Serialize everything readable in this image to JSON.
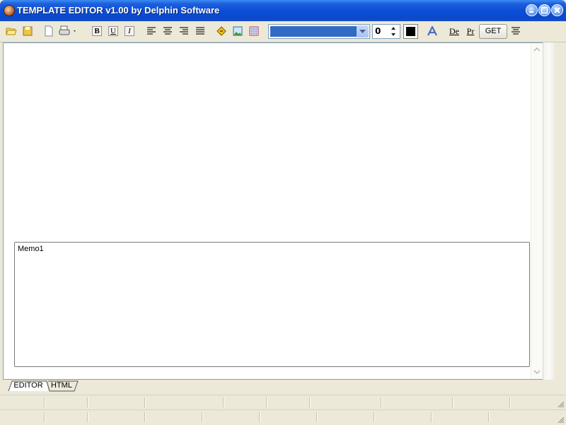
{
  "window": {
    "title": "TEMPLATE EDITOR v1.00 by Delphin Software"
  },
  "toolbar": {
    "buttons": [
      {
        "name": "open-folder-icon"
      },
      {
        "name": "save-icon"
      },
      {
        "name": "new-document-icon"
      },
      {
        "name": "print-icon"
      },
      {
        "name": "bold-button",
        "label": "B"
      },
      {
        "name": "underline-button",
        "label": "U"
      },
      {
        "name": "italic-button",
        "label": "I"
      },
      {
        "name": "align-left-icon"
      },
      {
        "name": "align-center-icon"
      },
      {
        "name": "align-right-icon"
      },
      {
        "name": "align-justify-icon"
      },
      {
        "name": "link-icon"
      },
      {
        "name": "image-icon"
      },
      {
        "name": "table-icon"
      }
    ],
    "font_size": "0",
    "text_color": "#000000",
    "extra_labels": {
      "de": "De",
      "pr": "Pr"
    },
    "get_label": "GET"
  },
  "memo": {
    "text": "Memo1"
  },
  "tabs": [
    {
      "label": "EDITOR",
      "active": true
    },
    {
      "label": "HTML",
      "active": false
    }
  ],
  "colors": {
    "titlebar": "#0a4fd8",
    "accent": "#316ac5"
  }
}
